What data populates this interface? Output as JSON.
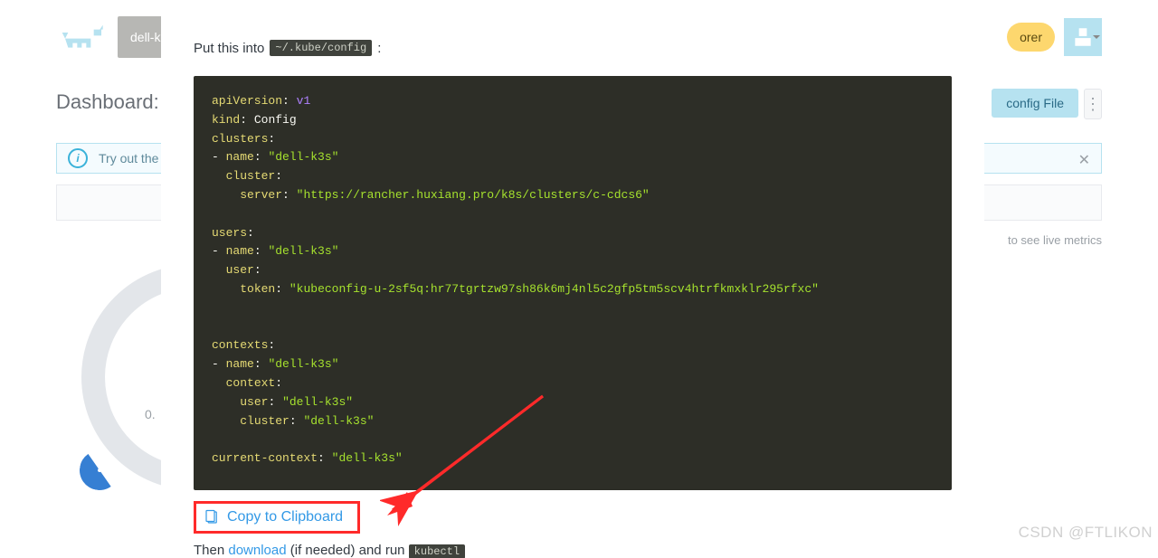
{
  "background": {
    "cluster_button": "dell-k",
    "explorer_button": "orer",
    "dashboard_title": "Dashboard: c",
    "kubeconfig_button": "config File",
    "banner_text": "Try out the",
    "metrics_hint": "to see live metrics",
    "gauge_zero": "0."
  },
  "modal": {
    "intro_prefix": "Put this into",
    "intro_path": "~/.kube/config",
    "intro_suffix": ":",
    "copy_label": "Copy to Clipboard",
    "then_prefix": "Then ",
    "then_link": "download",
    "then_mid": " (if needed) and run ",
    "then_cmd": "kubectl"
  },
  "yaml": {
    "k_apiVersion": "apiVersion",
    "v_apiVersion": "v1",
    "k_kind": "kind",
    "v_kind": "Config",
    "k_clusters": "clusters",
    "k_name": "name",
    "v_name_cluster": "\"dell-k3s\"",
    "k_cluster": "cluster",
    "k_server": "server",
    "v_server": "\"https://rancher.huxiang.pro/k8s/clusters/c-cdcs6\"",
    "k_users": "users",
    "v_name_user": "\"dell-k3s\"",
    "k_user": "user",
    "k_token": "token",
    "v_token": "\"kubeconfig-u-2sf5q:hr77tgrtzw97sh86k6mj4nl5c2gfp5tm5scv4htrfkmxklr295rfxc\"",
    "k_contexts": "contexts",
    "v_name_ctx": "\"dell-k3s\"",
    "k_context": "context",
    "v_ctx_user": "\"dell-k3s\"",
    "v_ctx_cluster": "\"dell-k3s\"",
    "k_currentctx": "current-context",
    "v_currentctx": "\"dell-k3s\""
  },
  "watermark": "CSDN @FTLIKON"
}
